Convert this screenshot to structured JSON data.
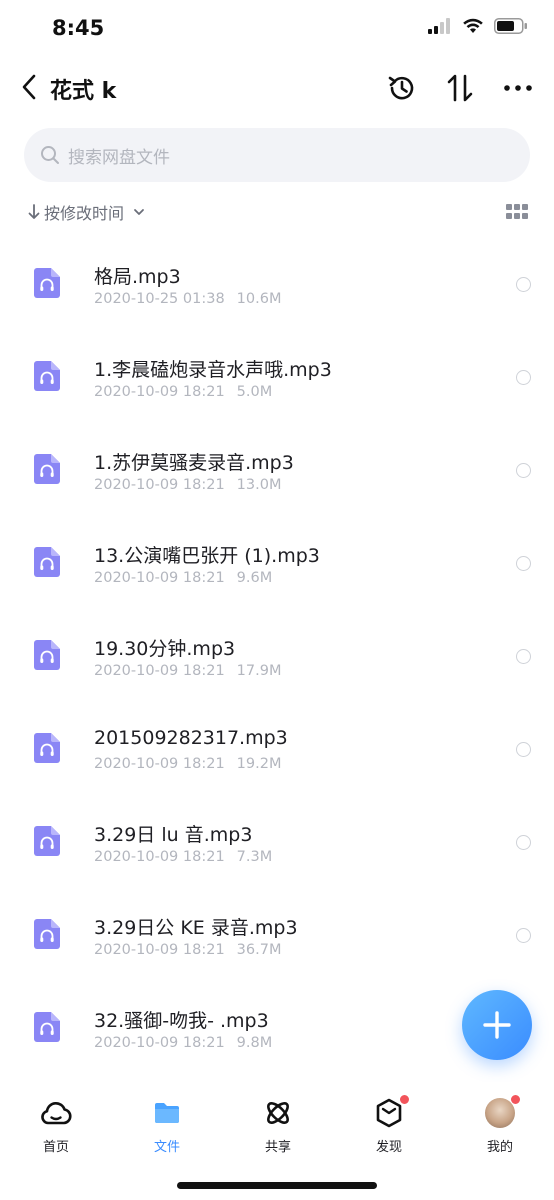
{
  "status_bar": {
    "time": "8:45"
  },
  "nav": {
    "title": "花式 k",
    "icons": [
      "back-arrow-icon",
      "history-icon",
      "sort-arrows-icon",
      "more-icon"
    ]
  },
  "search": {
    "placeholder": "搜索网盘文件"
  },
  "sort": {
    "label": "按修改时间",
    "icon": "down-arrow-icon"
  },
  "files": [
    {
      "name": "格局.mp3",
      "date": "2020-10-25 01:38",
      "size": "10.6M"
    },
    {
      "name": "1.李晨磕炮录音水声哦.mp3",
      "date": "2020-10-09 18:21",
      "size": "5.0M"
    },
    {
      "name": "1.苏伊莫骚麦录音.mp3",
      "date": "2020-10-09 18:21",
      "size": "13.0M"
    },
    {
      "name": "13.公演嘴巴张开 (1).mp3",
      "date": "2020-10-09 18:21",
      "size": "9.6M"
    },
    {
      "name": "19.30分钟.mp3",
      "date": "2020-10-09 18:21",
      "size": "17.9M"
    },
    {
      "name": "201509282317.mp3",
      "date": "2020-10-09 18:21",
      "size": "19.2M"
    },
    {
      "name": "3.29日 lu 音.mp3",
      "date": "2020-10-09 18:21",
      "size": "7.3M"
    },
    {
      "name": "3.29日公 KE 录音.mp3",
      "date": "2020-10-09 18:21",
      "size": "36.7M"
    },
    {
      "name": "32.骚御-吻我- .mp3",
      "date": "2020-10-09 18:21",
      "size": "9.8M"
    }
  ],
  "tabs": [
    {
      "label": "首页",
      "icon": "cloud-home-icon",
      "active": false
    },
    {
      "label": "文件",
      "icon": "folder-icon",
      "active": true
    },
    {
      "label": "共享",
      "icon": "share-atom-icon",
      "active": false
    },
    {
      "label": "发现",
      "icon": "discover-cube-icon",
      "active": false,
      "badge": true
    },
    {
      "label": "我的",
      "icon": "avatar",
      "active": false,
      "badge": true
    }
  ],
  "colors": {
    "accent": "#3a8cff",
    "file_icon": "#8a86f5",
    "badge": "#f2545b"
  }
}
